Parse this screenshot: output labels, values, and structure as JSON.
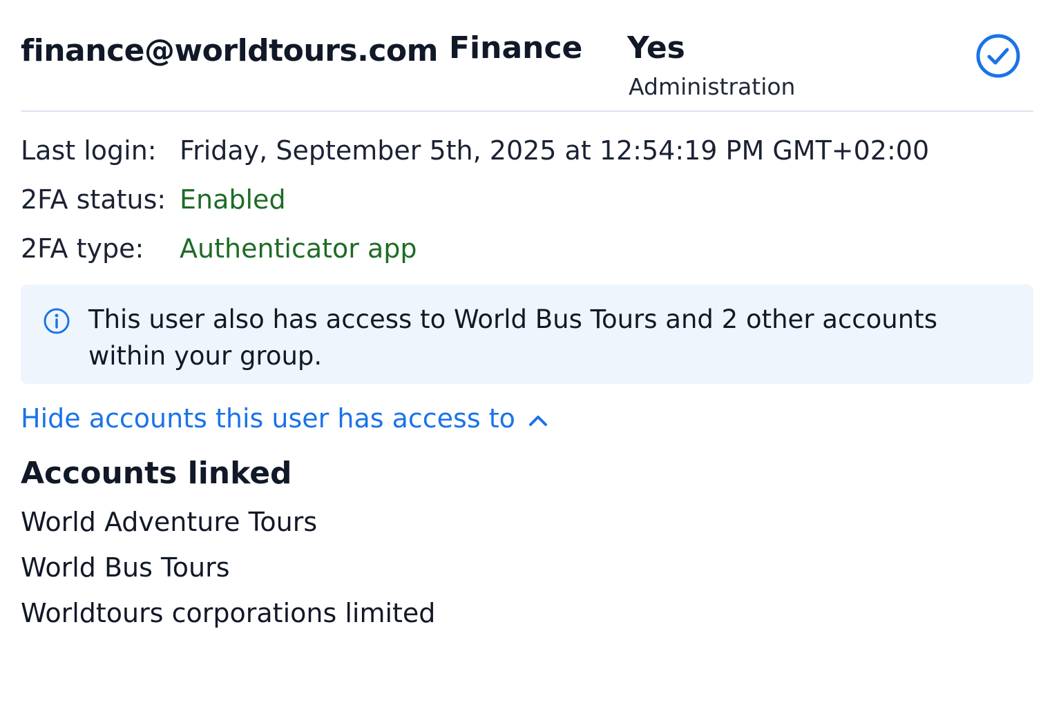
{
  "user": {
    "email": "finance@worldtours.com",
    "team": "Finance",
    "admin_value": "Yes",
    "admin_label": "Administration",
    "status_icon": "check-circle-icon"
  },
  "details": {
    "last_login_label": "Last login:",
    "last_login_value": "Friday, September 5th, 2025 at 12:54:19 PM GMT+02:00",
    "twofa_status_label": "2FA status:",
    "twofa_status_value": "Enabled",
    "twofa_type_label": "2FA type:",
    "twofa_type_value": "Authenticator app"
  },
  "notice": {
    "icon": "info-icon",
    "text": "This user also has access to World Bus Tours and 2 other accounts within your group."
  },
  "toggle": {
    "label": "Hide accounts this user has access to",
    "icon": "chevron-up-icon"
  },
  "accounts": {
    "title": "Accounts linked",
    "items": [
      "World Adventure Tours",
      "World Bus Tours",
      "Worldtours corporations limited"
    ]
  },
  "colors": {
    "accent": "#1a73e8",
    "success": "#1e6b26",
    "notice_bg": "#eef5fd",
    "divider": "#dbe3ef"
  }
}
